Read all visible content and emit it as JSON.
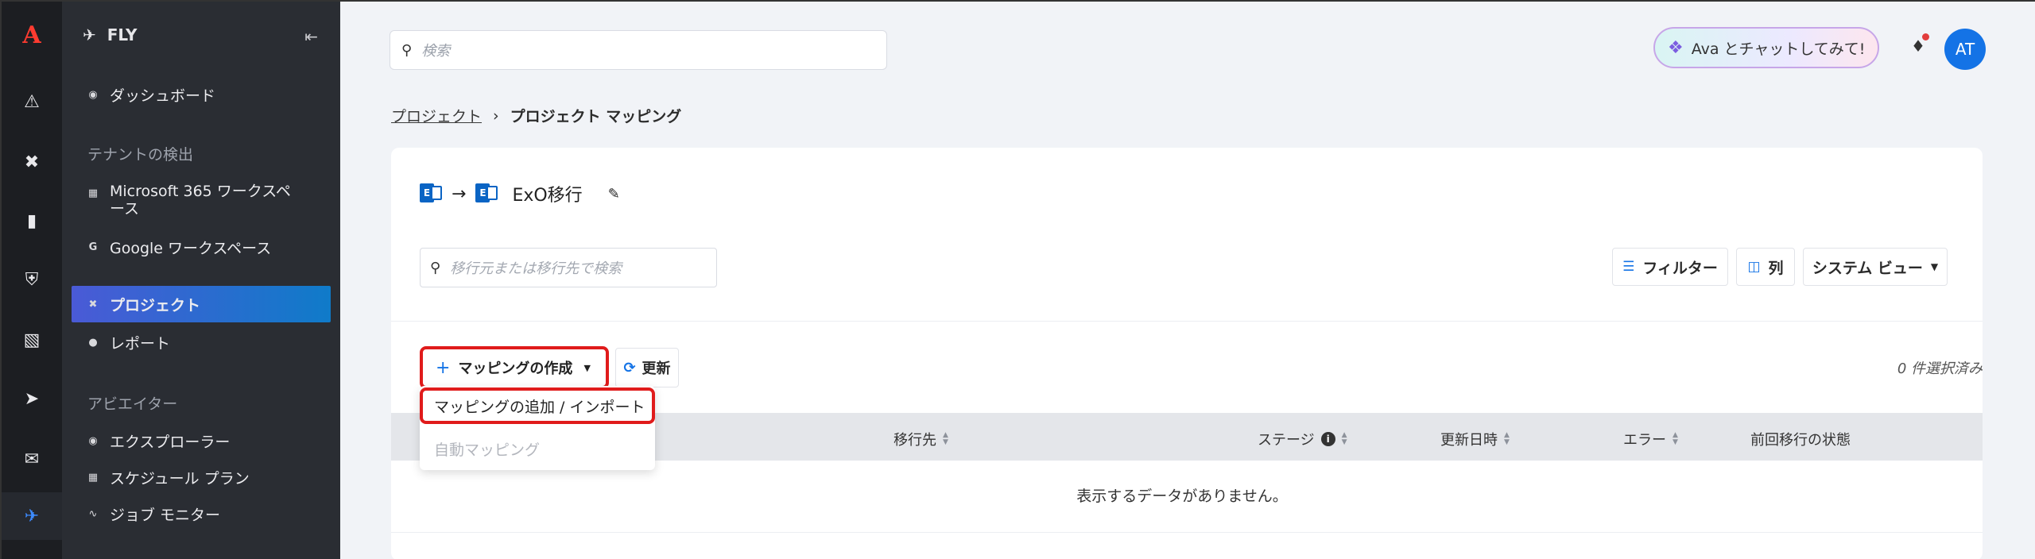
{
  "rail": {
    "logo": "A",
    "icons": [
      "alert-icon",
      "tools-icon",
      "building-icon",
      "shield-icon",
      "database-icon",
      "rocket-icon",
      "chat-icon",
      "airplane-icon"
    ]
  },
  "nav": {
    "brand": "FLY",
    "items": {
      "dashboard": "ダッシュボード",
      "tenant_section": "テナントの検出",
      "m365": "Microsoft 365 ワークスペース",
      "google": "Google ワークスペース",
      "projects": "プロジェクト",
      "reports": "レポート",
      "aviator_section": "アビエイター",
      "explorer": "エクスプローラー",
      "schedule": "スケジュール プラン",
      "job_monitor": "ジョブ モニター"
    }
  },
  "header": {
    "search_placeholder": "検索",
    "ava_label": "Ava とチャットしてみて!",
    "avatar_initials": "AT"
  },
  "breadcrumb": {
    "parent": "プロジェクト",
    "current": "プロジェクト マッピング"
  },
  "project": {
    "title": "ExO移行",
    "search_placeholder": "移行元または移行先で検索",
    "filter_label": "フィルター",
    "columns_label": "列",
    "view_label": "システム ビュー"
  },
  "actions": {
    "create_label": "マッピングの作成",
    "refresh_label": "更新",
    "selected_text": "0 件選択済み"
  },
  "dropdown": {
    "add_import": "マッピングの追加 / インポート",
    "auto_mapping": "自動マッピング"
  },
  "table": {
    "headers": {
      "destination": "移行先",
      "stage": "ステージ",
      "updated": "更新日時",
      "errors": "エラー",
      "last_status": "前回移行の状態"
    },
    "empty_text": "表示するデータがありません。"
  },
  "colors": {
    "accent": "#1473e6",
    "highlight": "#e01b1b"
  }
}
